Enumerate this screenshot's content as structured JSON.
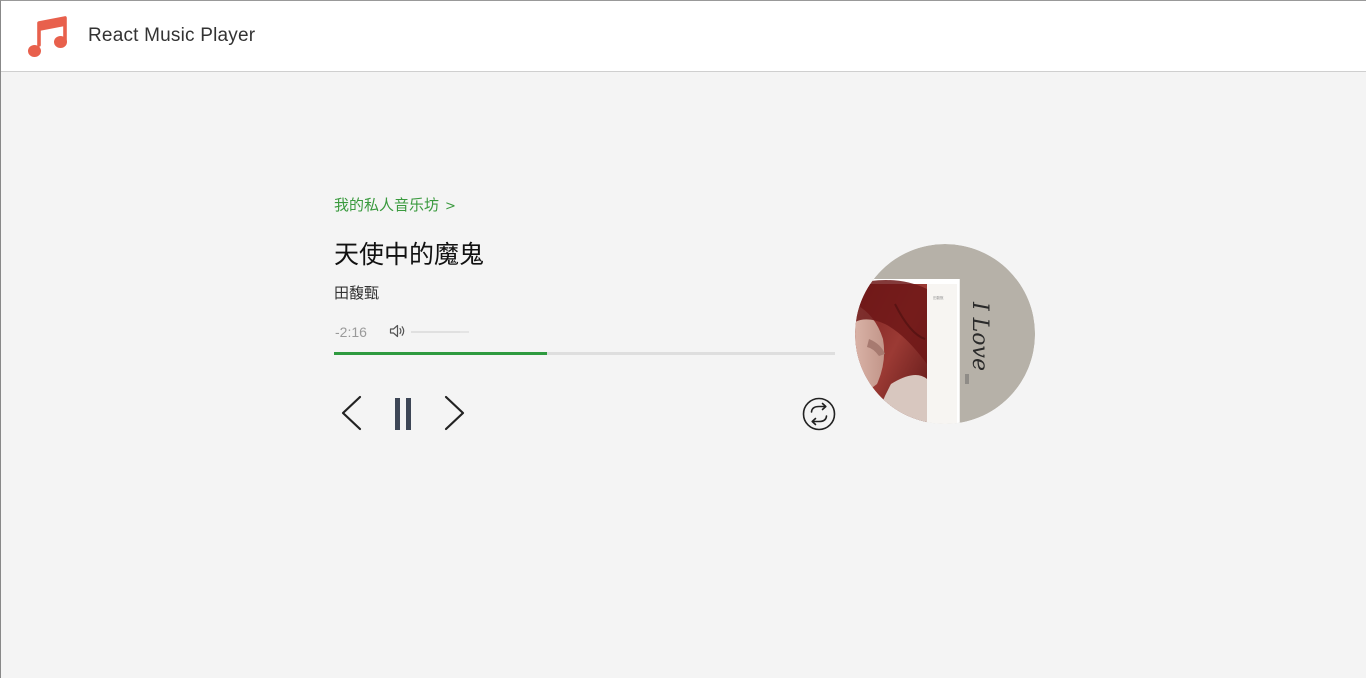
{
  "header": {
    "logo_icon": "music-note-icon",
    "title": "React Music Player",
    "brand_color": "#e8604c"
  },
  "player": {
    "collection_link": "我的私人音乐坊",
    "collection_chevron": ">",
    "song_title": "天使中的魔鬼",
    "artist": "田馥甄",
    "time_left": "-2:16",
    "volume_icon": "speaker-icon",
    "volume_level": 0.85,
    "progress": 0.425,
    "accent_color": "#2e9a3f",
    "controls": {
      "prev_icon": "chevron-left-icon",
      "pause_icon": "pause-icon",
      "next_icon": "chevron-right-icon",
      "repeat_icon": "repeat-cycle-icon"
    },
    "album_cover_text": "I Love"
  }
}
